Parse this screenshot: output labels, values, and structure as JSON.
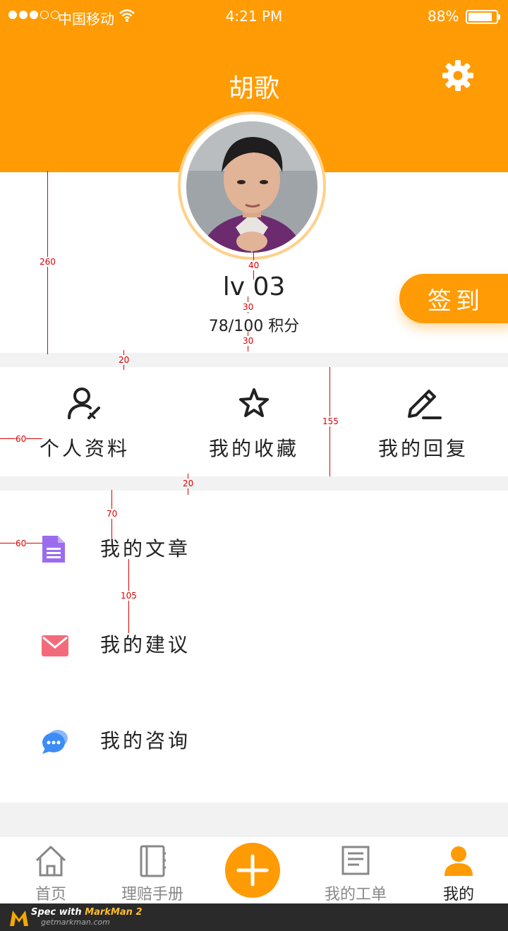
{
  "status_bar": {
    "carrier": "中国移动",
    "time": "4:21 PM",
    "battery_text": "88%",
    "battery_level": 0.88
  },
  "header": {
    "title": "胡歌",
    "settings_icon": "gear-icon",
    "bg_color": "#ff9b05"
  },
  "profile": {
    "level": "lv 03",
    "points": "78/100 积分",
    "signin_label": "签到"
  },
  "quick_actions": [
    {
      "label": "个人资料",
      "icon": "user-edit-icon"
    },
    {
      "label": "我的收藏",
      "icon": "star-icon"
    },
    {
      "label": "我的回复",
      "icon": "pencil-icon"
    }
  ],
  "list": [
    {
      "label": "我的文章",
      "icon": "document-icon",
      "color": "#9b6cf0"
    },
    {
      "label": "我的建议",
      "icon": "mail-icon",
      "color": "#f36b7b"
    },
    {
      "label": "我的咨询",
      "icon": "chat-icon",
      "color": "#3c8cf5"
    }
  ],
  "tabbar": {
    "items": [
      {
        "label": "首页",
        "icon": "home-icon"
      },
      {
        "label": "理赔手册",
        "icon": "notebook-icon"
      },
      {
        "label": "",
        "icon": "plus-icon"
      },
      {
        "label": "我的工单",
        "icon": "worksheet-icon"
      },
      {
        "label": "我的",
        "icon": "person-icon"
      }
    ],
    "active": "我的"
  },
  "watermark": {
    "line1_prefix": "Spec with",
    "line1_brand": "MarkMan 2",
    "line2": "getmarkman.com"
  },
  "spec_annotations": [
    "260",
    "20",
    "40",
    "30",
    "30",
    "60",
    "155",
    "20",
    "70",
    "60",
    "105"
  ]
}
